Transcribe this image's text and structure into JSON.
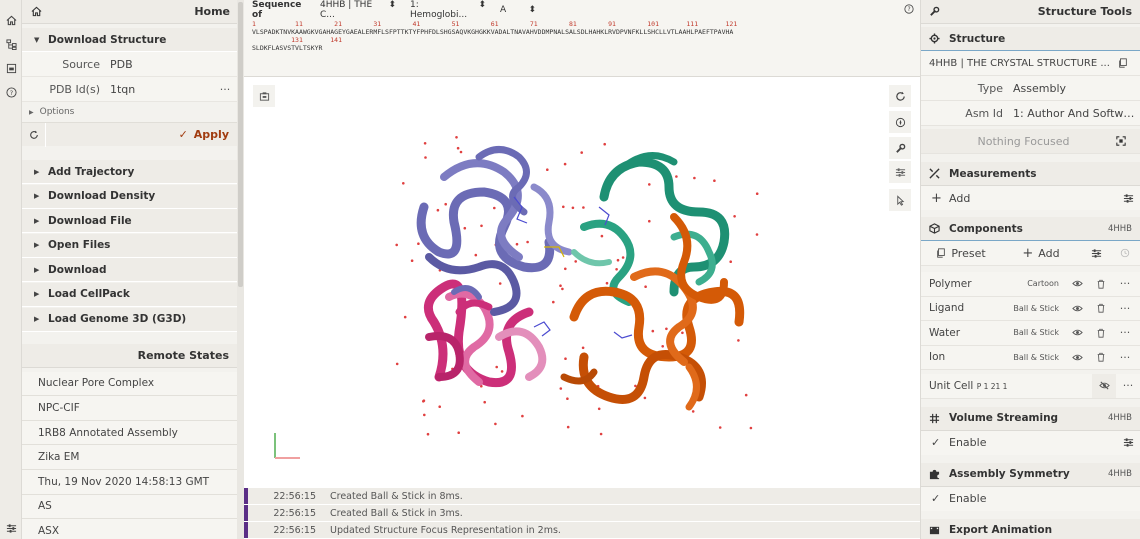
{
  "left_panel": {
    "home_label": "Home",
    "download_structure": {
      "title": "Download Structure",
      "source_label": "Source",
      "source_value": "PDB",
      "pdb_ids_label": "PDB Id(s)",
      "pdb_ids_value": "1tqn",
      "options_label": "Options",
      "apply_label": "Apply"
    },
    "actions": [
      "Add Trajectory",
      "Download Density",
      "Download File",
      "Open Files",
      "Download",
      "Load CellPack",
      "Load Genome 3D (G3D)"
    ],
    "remote_states_title": "Remote States",
    "remote_states": [
      "Nuclear Pore Complex",
      "NPC-CIF",
      "1RB8 Annotated Assembly",
      "Zika EM",
      "Thu, 19 Nov 2020 14:58:13 GMT",
      "AS",
      "ASX"
    ]
  },
  "sequence": {
    "label": "Sequence of",
    "structure_select": "4HHB | THE C...",
    "entity_select": "1: Hemoglobi...",
    "chain_select": "A",
    "numbers_line1": "1          11        21        31        41        51        61        71        81        91        101       111       121",
    "residues_line1": "VLSPADKTNVKAAWGKVGAHAGEYGAEALERMFLSFPTTKTYFPHFDLSHGSAQVKGHGKKVADALTNAVAHVDDMPNALSALSDLHAHKLRVDPVNFKLLSHCLLVTLAAHLPAEFTPAVHA",
    "numbers_line2": "          131       141",
    "residues_line2": "SLDKFLASVSTVLTSKYR"
  },
  "log": [
    {
      "time": "22:56:15",
      "message": "Created Ball & Stick in 8ms."
    },
    {
      "time": "22:56:15",
      "message": "Created Ball & Stick in 3ms."
    },
    {
      "time": "22:56:15",
      "message": "Updated Structure Focus Representation in 2ms."
    }
  ],
  "right_panel": {
    "title": "Structure Tools",
    "structure_title": "Structure",
    "structure_name": "4HHB | THE CRYSTAL STRUCTURE ...",
    "type_label": "Type",
    "type_value": "Assembly",
    "asm_label": "Asm Id",
    "asm_value": "1: Author And Softwar...",
    "nothing_focused": "Nothing Focused",
    "measurements_title": "Measurements",
    "add_label": "Add",
    "components_title": "Components",
    "components_tag": "4HHB",
    "preset_label": "Preset",
    "components": [
      {
        "name": "Polymer",
        "repr": "Cartoon"
      },
      {
        "name": "Ligand",
        "repr": "Ball & Stick"
      },
      {
        "name": "Water",
        "repr": "Ball & Stick"
      },
      {
        "name": "Ion",
        "repr": "Ball & Stick"
      }
    ],
    "unit_cell_label": "Unit Cell",
    "unit_cell_group": "P 1 21 1",
    "volume_title": "Volume Streaming",
    "volume_tag": "4HHB",
    "enable_label": "Enable",
    "symmetry_title": "Assembly Symmetry",
    "symmetry_tag": "4HHB",
    "export_title": "Export Animation"
  },
  "colors": {
    "accent_apply": "#a13c10",
    "chain_purple": "#6b6bb5",
    "chain_green": "#1e9073",
    "chain_orange": "#d45a07",
    "chain_pink": "#cc2f79",
    "log_bar": "#5a2e86"
  }
}
